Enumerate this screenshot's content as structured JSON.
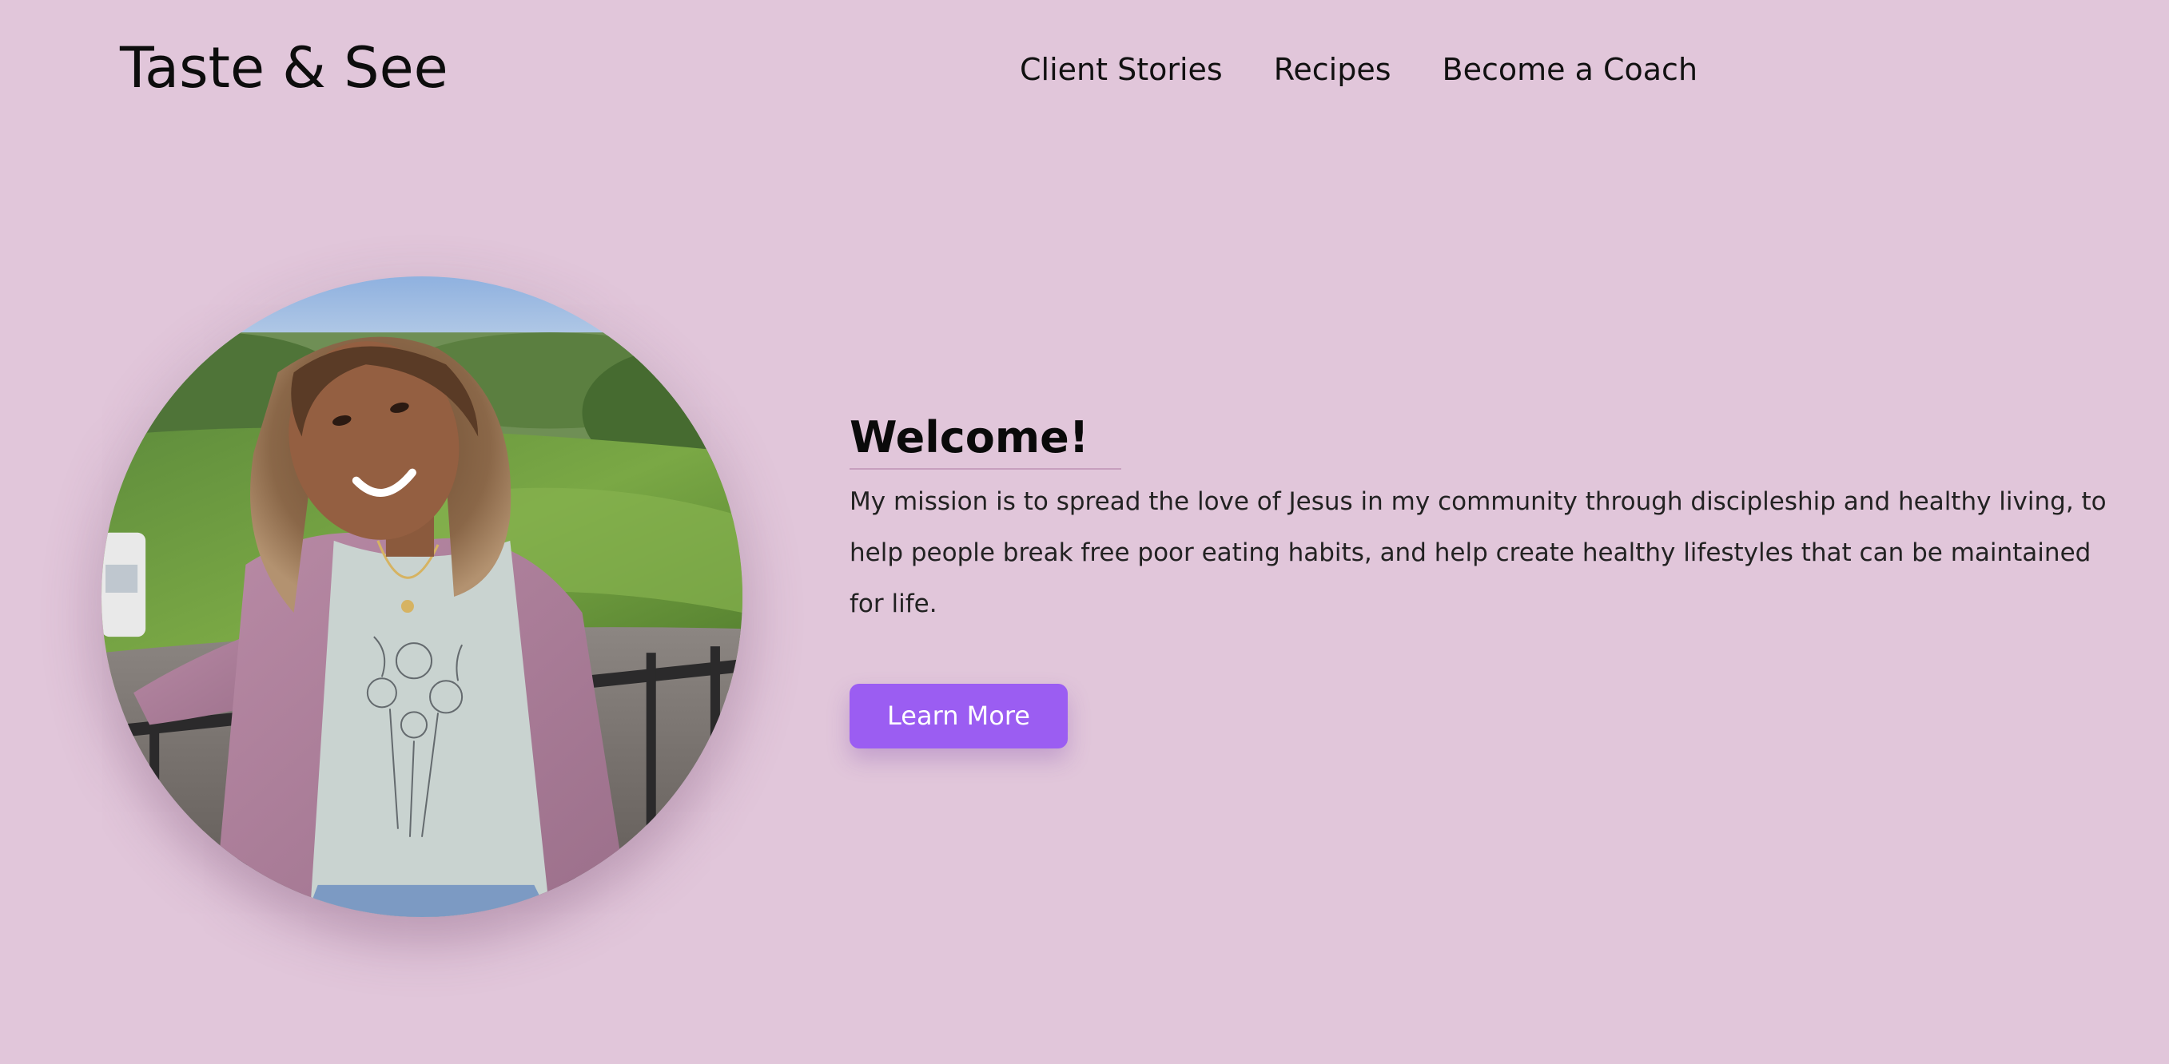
{
  "header": {
    "brand": "Taste & See",
    "nav": [
      {
        "label": "Client Stories"
      },
      {
        "label": "Recipes"
      },
      {
        "label": "Become a Coach"
      }
    ]
  },
  "hero": {
    "title": "Welcome!",
    "mission": "My mission is to spread the love of Jesus in my community through discipleship and healthy living, to help people break free poor eating habits, and help create healthy lifestyles that can be maintained for life.",
    "cta_label": "Learn More"
  },
  "colors": {
    "background": "#e1c6da",
    "accent": "#9b5df2",
    "text": "#1b1b1b"
  }
}
